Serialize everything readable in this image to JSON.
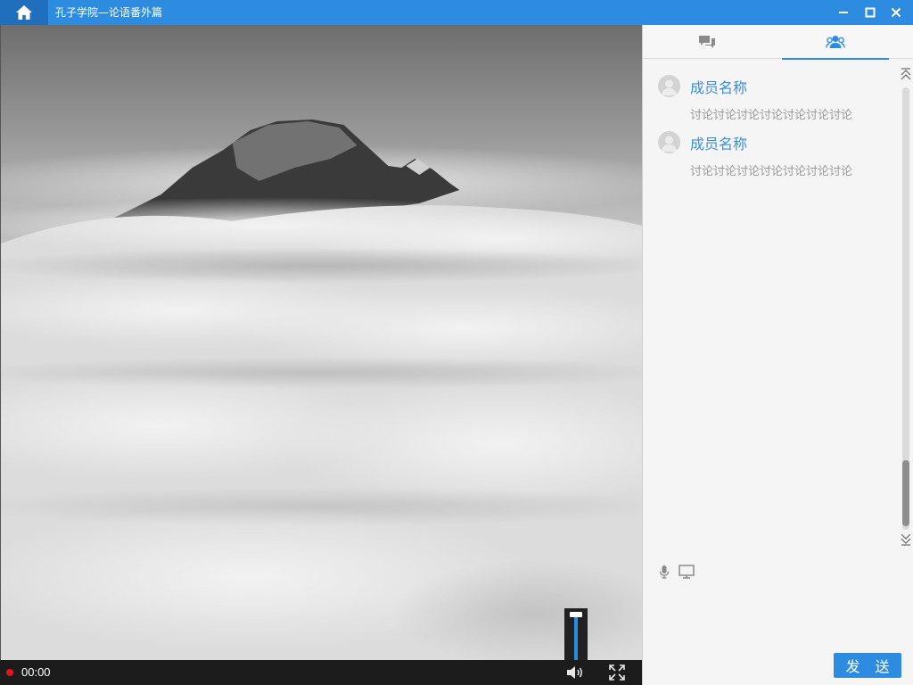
{
  "window": {
    "title": "孔子学院—论语番外篇",
    "icons": {
      "home": "home-icon",
      "minimize": "minimize-icon",
      "maximize": "maximize-icon",
      "close": "close-icon"
    }
  },
  "player": {
    "time": "00:00",
    "recording": true,
    "volume_percent": 100,
    "icons": {
      "record": "record-dot-icon",
      "volume": "volume-icon",
      "fullscreen": "fullscreen-icon"
    }
  },
  "sidepanel": {
    "tabs": [
      {
        "icon": "chat-bubbles-icon",
        "active": false
      },
      {
        "icon": "members-icon",
        "active": true
      }
    ],
    "messages": [
      {
        "name": "成员名称",
        "text": "讨论讨论讨论讨论讨论讨论讨论"
      },
      {
        "name": "成员名称",
        "text": "讨论讨论讨论讨论讨论讨论讨论"
      }
    ],
    "tools": [
      {
        "icon": "microphone-icon"
      },
      {
        "icon": "screen-share-icon"
      }
    ],
    "send_label": "发 送"
  },
  "colors": {
    "accent": "#2e8ce0",
    "titlebar_dark": "#1f6fbd",
    "name_link": "#3a8fd6",
    "record": "#e0161b"
  }
}
